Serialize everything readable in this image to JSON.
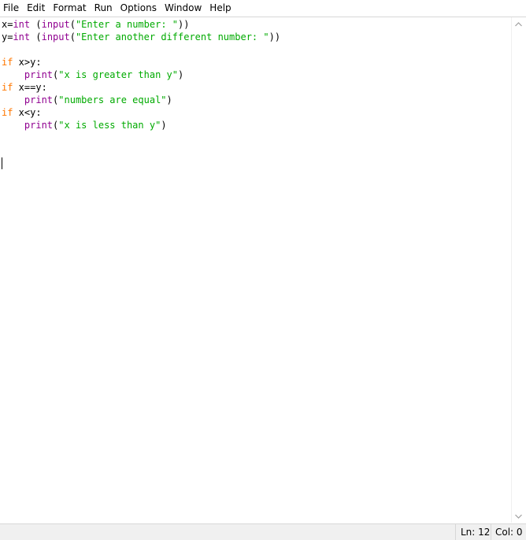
{
  "menubar": {
    "items": [
      "File",
      "Edit",
      "Format",
      "Run",
      "Options",
      "Window",
      "Help"
    ]
  },
  "editor": {
    "lines": [
      [
        {
          "t": "x=",
          "c": ""
        },
        {
          "t": "int",
          "c": "kw-builtin"
        },
        {
          "t": " (",
          "c": ""
        },
        {
          "t": "input",
          "c": "kw-builtin"
        },
        {
          "t": "(",
          "c": ""
        },
        {
          "t": "\"Enter a number: \"",
          "c": "str"
        },
        {
          "t": "))",
          "c": ""
        }
      ],
      [
        {
          "t": "y=",
          "c": ""
        },
        {
          "t": "int",
          "c": "kw-builtin"
        },
        {
          "t": " (",
          "c": ""
        },
        {
          "t": "input",
          "c": "kw-builtin"
        },
        {
          "t": "(",
          "c": ""
        },
        {
          "t": "\"Enter another different number: \"",
          "c": "str"
        },
        {
          "t": "))",
          "c": ""
        }
      ],
      [],
      [
        {
          "t": "if",
          "c": "kw"
        },
        {
          "t": " x>y:",
          "c": ""
        }
      ],
      [
        {
          "t": "    ",
          "c": ""
        },
        {
          "t": "print",
          "c": "kw-builtin"
        },
        {
          "t": "(",
          "c": ""
        },
        {
          "t": "\"x is greater than y\"",
          "c": "str"
        },
        {
          "t": ")",
          "c": ""
        }
      ],
      [
        {
          "t": "if",
          "c": "kw"
        },
        {
          "t": " x==y:",
          "c": ""
        }
      ],
      [
        {
          "t": "    ",
          "c": ""
        },
        {
          "t": "print",
          "c": "kw-builtin"
        },
        {
          "t": "(",
          "c": ""
        },
        {
          "t": "\"numbers are equal\"",
          "c": "str"
        },
        {
          "t": ")",
          "c": ""
        }
      ],
      [
        {
          "t": "if",
          "c": "kw"
        },
        {
          "t": " x<y:",
          "c": ""
        }
      ],
      [
        {
          "t": "    ",
          "c": ""
        },
        {
          "t": "print",
          "c": "kw-builtin"
        },
        {
          "t": "(",
          "c": ""
        },
        {
          "t": "\"x is less than y\"",
          "c": "str"
        },
        {
          "t": ")",
          "c": ""
        }
      ],
      [],
      [],
      []
    ],
    "colors": {
      "builtin": "#900090",
      "keyword": "#ff7700",
      "string": "#00aa00"
    }
  },
  "statusbar": {
    "line": "Ln: 12",
    "col": "Col: 0"
  },
  "icons": {
    "scroll_up": "chevron-up-icon",
    "scroll_down": "chevron-down-icon"
  }
}
